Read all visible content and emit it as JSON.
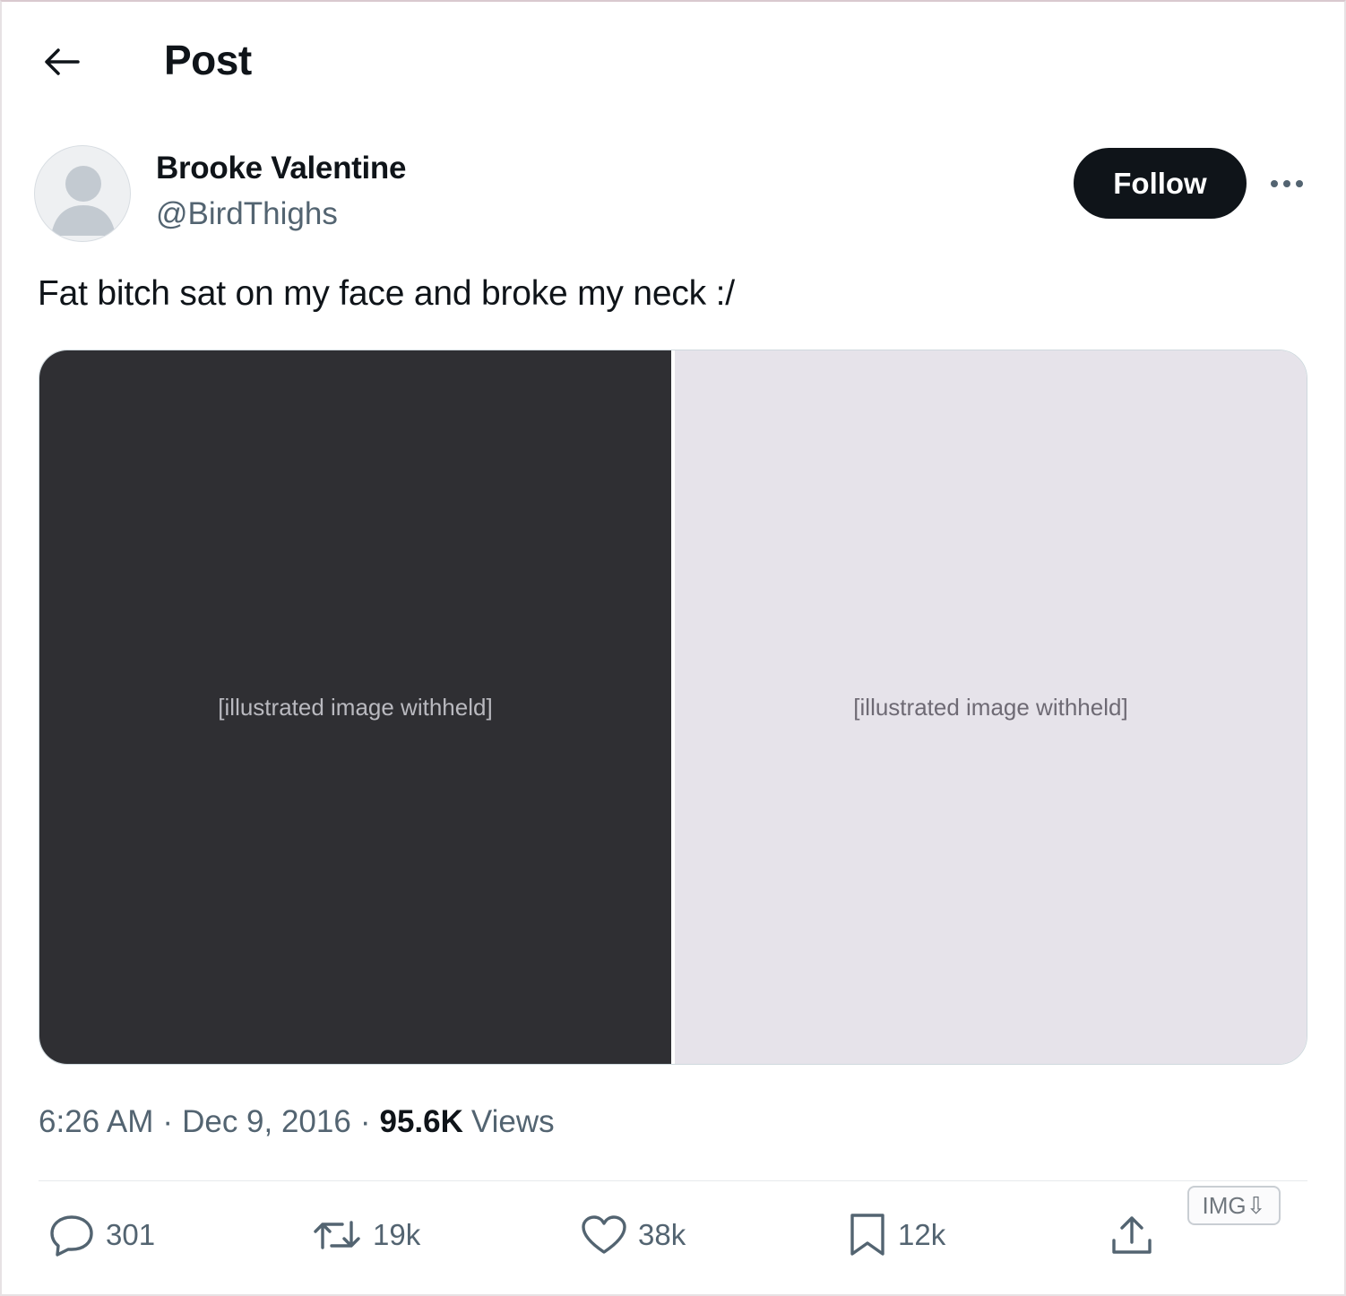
{
  "header": {
    "title": "Post"
  },
  "author": {
    "display_name": "Brooke Valentine",
    "handle": "@BirdThighs"
  },
  "follow_label": "Follow",
  "post": {
    "text": "Fat bitch sat on my face and broke my neck :/",
    "media": [
      {
        "label": "[illustrated image withheld]"
      },
      {
        "label": "[illustrated image withheld]"
      }
    ]
  },
  "meta": {
    "time": "6:26 AM",
    "separator": "·",
    "date": "Dec 9, 2016",
    "views_count": "95.6K",
    "views_label": "Views"
  },
  "actions": {
    "reply_count": "301",
    "repost_count": "19k",
    "like_count": "38k",
    "bookmark_count": "12k"
  },
  "extension_badge": "IMG⇩",
  "colors": {
    "text_primary": "#0f1419",
    "text_secondary": "#536471",
    "follow_bg": "#0f1419",
    "divider": "#e6e9ec"
  },
  "icons": [
    "back-arrow-icon",
    "more-icon",
    "reply-icon",
    "repost-icon",
    "like-icon",
    "bookmark-icon",
    "share-icon"
  ]
}
